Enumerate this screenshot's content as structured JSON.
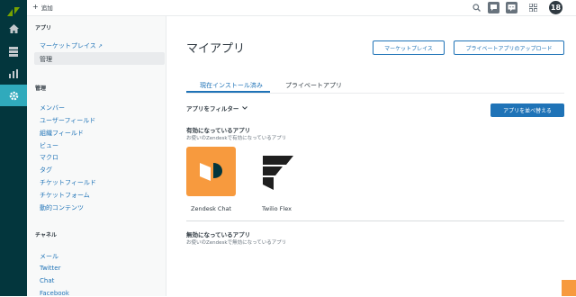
{
  "topbar": {
    "add_label": "追加",
    "avatar_text": "18"
  },
  "sidebar": {
    "apps_title": "アプリ",
    "marketplace": "マーケットプレイス",
    "manage": "管理",
    "manage_title": "管理",
    "manage_items": [
      "メンバー",
      "ユーザーフィールド",
      "組織フィールド",
      "ビュー",
      "マクロ",
      "タグ",
      "チケットフィールド",
      "チケットフォーム",
      "動的コンテンツ"
    ],
    "channels_title": "チャネル",
    "channel_items": [
      "メール",
      "Twitter",
      "Chat",
      "Facebook"
    ]
  },
  "main": {
    "title": "マイアプリ",
    "marketplace_button": "マーケットプレイス",
    "private_upload_button": "プライベートアプリのアップロード",
    "tabs": [
      "現在インストール済み",
      "プライベートアプリ"
    ],
    "filter_label": "アプリをフィルター",
    "reorder_button": "アプリを並べ替える",
    "enabled_heading": "有効になっているアプリ",
    "enabled_desc": "お使いのZendeskで有効になっているアプリ",
    "apps": [
      {
        "name": "Zendesk Chat",
        "color": "#f79a3e"
      },
      {
        "name": "Twilio Flex",
        "color": "#ffffff"
      }
    ],
    "disabled_heading": "無効になっているアプリ",
    "disabled_desc": "お使いのZendeskで無効になっているアプリ"
  },
  "colors": {
    "rail": "#03363d",
    "accent": "#1f73b7",
    "active_nav": "#30aabc"
  }
}
